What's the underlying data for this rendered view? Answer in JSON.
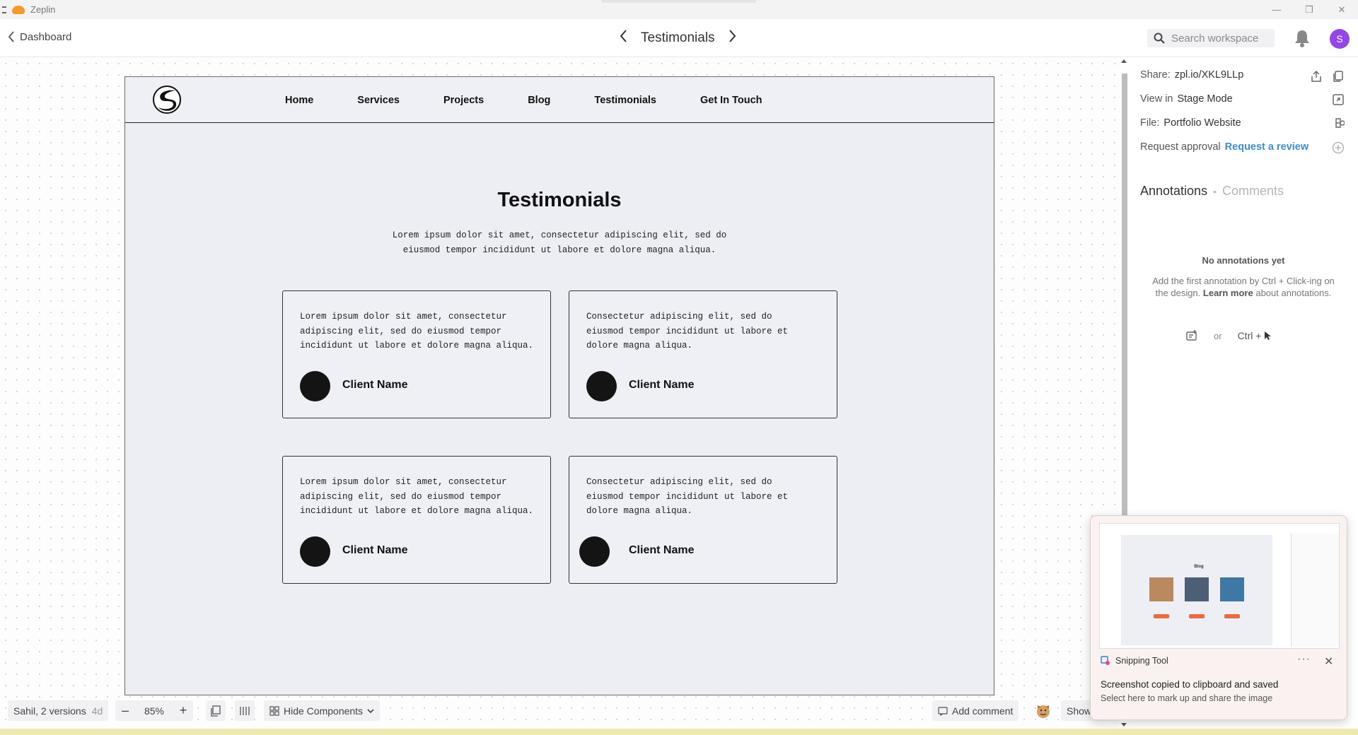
{
  "window": {
    "app_name": "Zeplin"
  },
  "header": {
    "back_label": "Dashboard",
    "screen_title": "Testimonials",
    "search_placeholder": "Search workspace",
    "user_initial": "S"
  },
  "design": {
    "nav": [
      "Home",
      "Services",
      "Projects",
      "Blog",
      "Testimonials",
      "Get In Touch"
    ],
    "title": "Testimonials",
    "subtitle_line1": "Lorem ipsum dolor sit amet, consectetur adipiscing elit, sed do",
    "subtitle_line2": "eiusmod tempor incididunt ut labore et dolore magna aliqua.",
    "cards": [
      {
        "text": [
          "Lorem ipsum dolor sit amet, consectetur",
          "adipiscing elit, sed do eiusmod tempor",
          "incididunt ut labore et dolore magna aliqua."
        ],
        "name": "Client Name"
      },
      {
        "text": [
          "Consectetur adipiscing elit, sed do",
          "eiusmod tempor incididunt ut labore et",
          "dolore magna aliqua."
        ],
        "name": "Client Name"
      },
      {
        "text": [
          "Lorem ipsum dolor sit amet, consectetur",
          "adipiscing elit, sed do eiusmod tempor",
          "incididunt ut labore et dolore magna aliqua."
        ],
        "name": "Client Name"
      },
      {
        "text": [
          "Consectetur adipiscing elit, sed do",
          "eiusmod tempor incididunt ut labore et",
          "dolore magna aliqua."
        ],
        "name": "Client Name"
      }
    ]
  },
  "sidebar": {
    "share_label": "Share:",
    "share_value": "zpl.io/XKL9LLp",
    "view_label": "View in",
    "view_value": "Stage Mode",
    "file_label": "File:",
    "file_value": "Portfolio Website",
    "approval_label": "Request approval",
    "approval_link": "Request a review",
    "tab_annotations": "Annotations",
    "tab_comments": "Comments",
    "empty_title": "No annotations yet",
    "empty_text_1": "Add the first annotation by Ctrl + Click-ing on the design.",
    "empty_learn_more": "Learn more",
    "empty_text_2": "about annotations.",
    "hint_or": "or",
    "hint_shortcut": "Ctrl +"
  },
  "bottombar": {
    "versions_label": "Sahil, 2 versions",
    "versions_age": "4d",
    "zoom": "85%",
    "hide_components": "Hide Components",
    "add_comment": "Add comment",
    "show_label": "Show"
  },
  "toast": {
    "app_name": "Snipping Tool",
    "more": "···",
    "title": "Screenshot copied to clipboard and saved",
    "subtitle": "Select here to mark up and share the image",
    "thumb_heading": "Blog"
  },
  "colors": {
    "accent": "#3a8fd9",
    "user_avatar": "#9447e8",
    "app_logo": "#f39a2a"
  },
  "icons": [
    "chevron-left-icon",
    "chevron-right-icon",
    "search-icon",
    "bell-icon",
    "export-icon",
    "copy-icon",
    "expand-icon",
    "file-icon",
    "plus-circle-icon",
    "annotation-icon",
    "cursor-icon",
    "pages-icon",
    "grid-icon",
    "components-icon",
    "comment-icon",
    "emoji-icon",
    "snipping-tool-icon",
    "close-icon"
  ]
}
